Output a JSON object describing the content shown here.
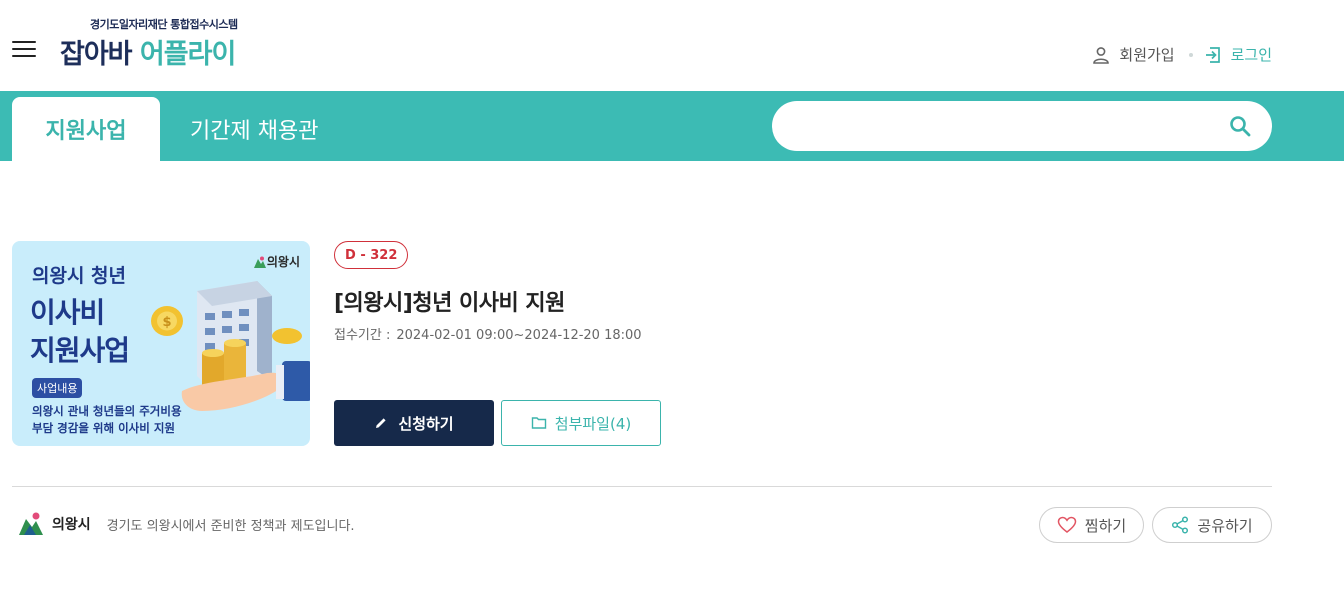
{
  "header": {
    "logo_sub": "경기도일자리재단 통합접수시스템",
    "logo_part1": "잡아바 ",
    "logo_part2": "어플라이",
    "join_label": "회원가입",
    "login_label": "로그인"
  },
  "tabs": [
    {
      "label": "지원사업",
      "active": true
    },
    {
      "label": "기간제 채용관",
      "active": false
    }
  ],
  "search": {
    "value": "",
    "placeholder": ""
  },
  "program": {
    "dday": "D - 322",
    "title": "[의왕시]청년 이사비 지원",
    "period_label": "접수기간 :",
    "period_value": "2024-02-01 09:00~2024-12-20 18:00",
    "thumbnail": {
      "line1": "의왕시 청년",
      "line2": "이사비",
      "line3": "지원사업",
      "chip": "사업내용",
      "desc1": "의왕시 관내 청년들의 주거비용",
      "desc2": "부담 경감을 위해 이사비 지원",
      "brand": "의왕시"
    },
    "apply_label": "신청하기",
    "files_label": "첨부파일(4)"
  },
  "footer": {
    "org_name": "의왕시",
    "org_text": "경기도 의왕시에서 준비한 정책과 제도입니다.",
    "like_label": "찜하기",
    "share_label": "공유하기"
  },
  "colors": {
    "teal": "#3cbbb4",
    "navy": "#16294a",
    "dday_red": "#d0303a"
  },
  "icons": [
    "menu-icon",
    "user-icon",
    "login-icon",
    "search-icon",
    "pencil-icon",
    "folder-icon",
    "heart-icon",
    "share-icon"
  ]
}
